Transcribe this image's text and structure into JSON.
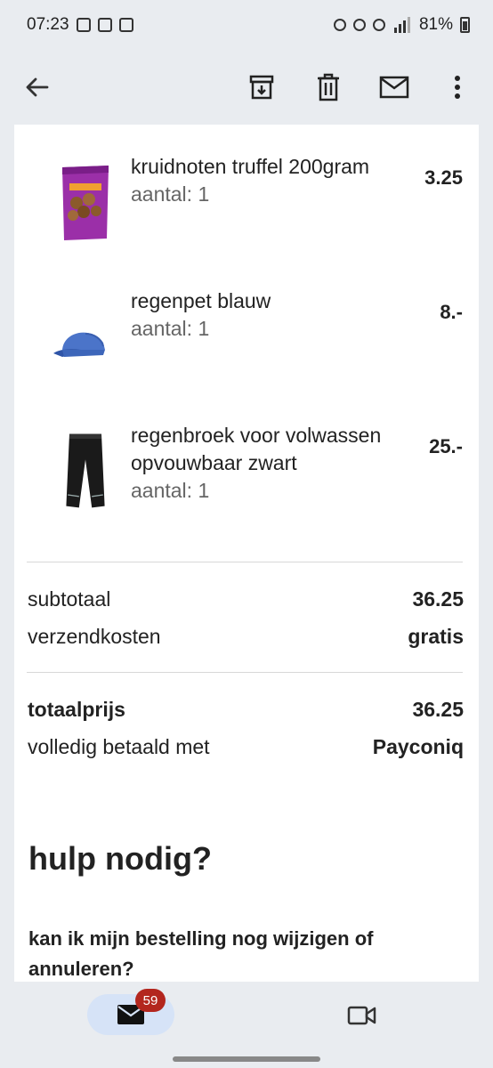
{
  "status_bar": {
    "time": "07:23",
    "battery": "81%"
  },
  "toolbar": {
    "back_icon": "arrow-left-icon",
    "archive_icon": "archive-icon",
    "delete_icon": "trash-icon",
    "mark_unread_icon": "mail-icon",
    "more_icon": "more-vert-icon"
  },
  "items": [
    {
      "name": "kruidnoten truffel 200gram",
      "qty": "aantal: 1",
      "price": "3.25"
    },
    {
      "name": "regenpet blauw",
      "qty": "aantal: 1",
      "price": "8.-"
    },
    {
      "name": "regenbroek voor volwassen opvouwbaar zwart",
      "qty": "aantal: 1",
      "price": "25.-"
    }
  ],
  "summary": {
    "subtotal_label": "subtotaal",
    "subtotal_value": "36.25",
    "shipping_label": "verzendkosten",
    "shipping_value": "gratis",
    "total_label": "totaalprijs",
    "total_value": "36.25",
    "paid_label": "volledig betaald met",
    "paid_value": "Payconiq"
  },
  "help": {
    "title": "hulp nodig?",
    "question": "kan ik mijn bestelling nog wijzigen of annuleren?"
  },
  "bottom_nav": {
    "mail_badge": "59"
  },
  "colors": {
    "background": "#e9ecf0",
    "badge": "#b3261e",
    "active_pill": "#d6e3f7"
  }
}
